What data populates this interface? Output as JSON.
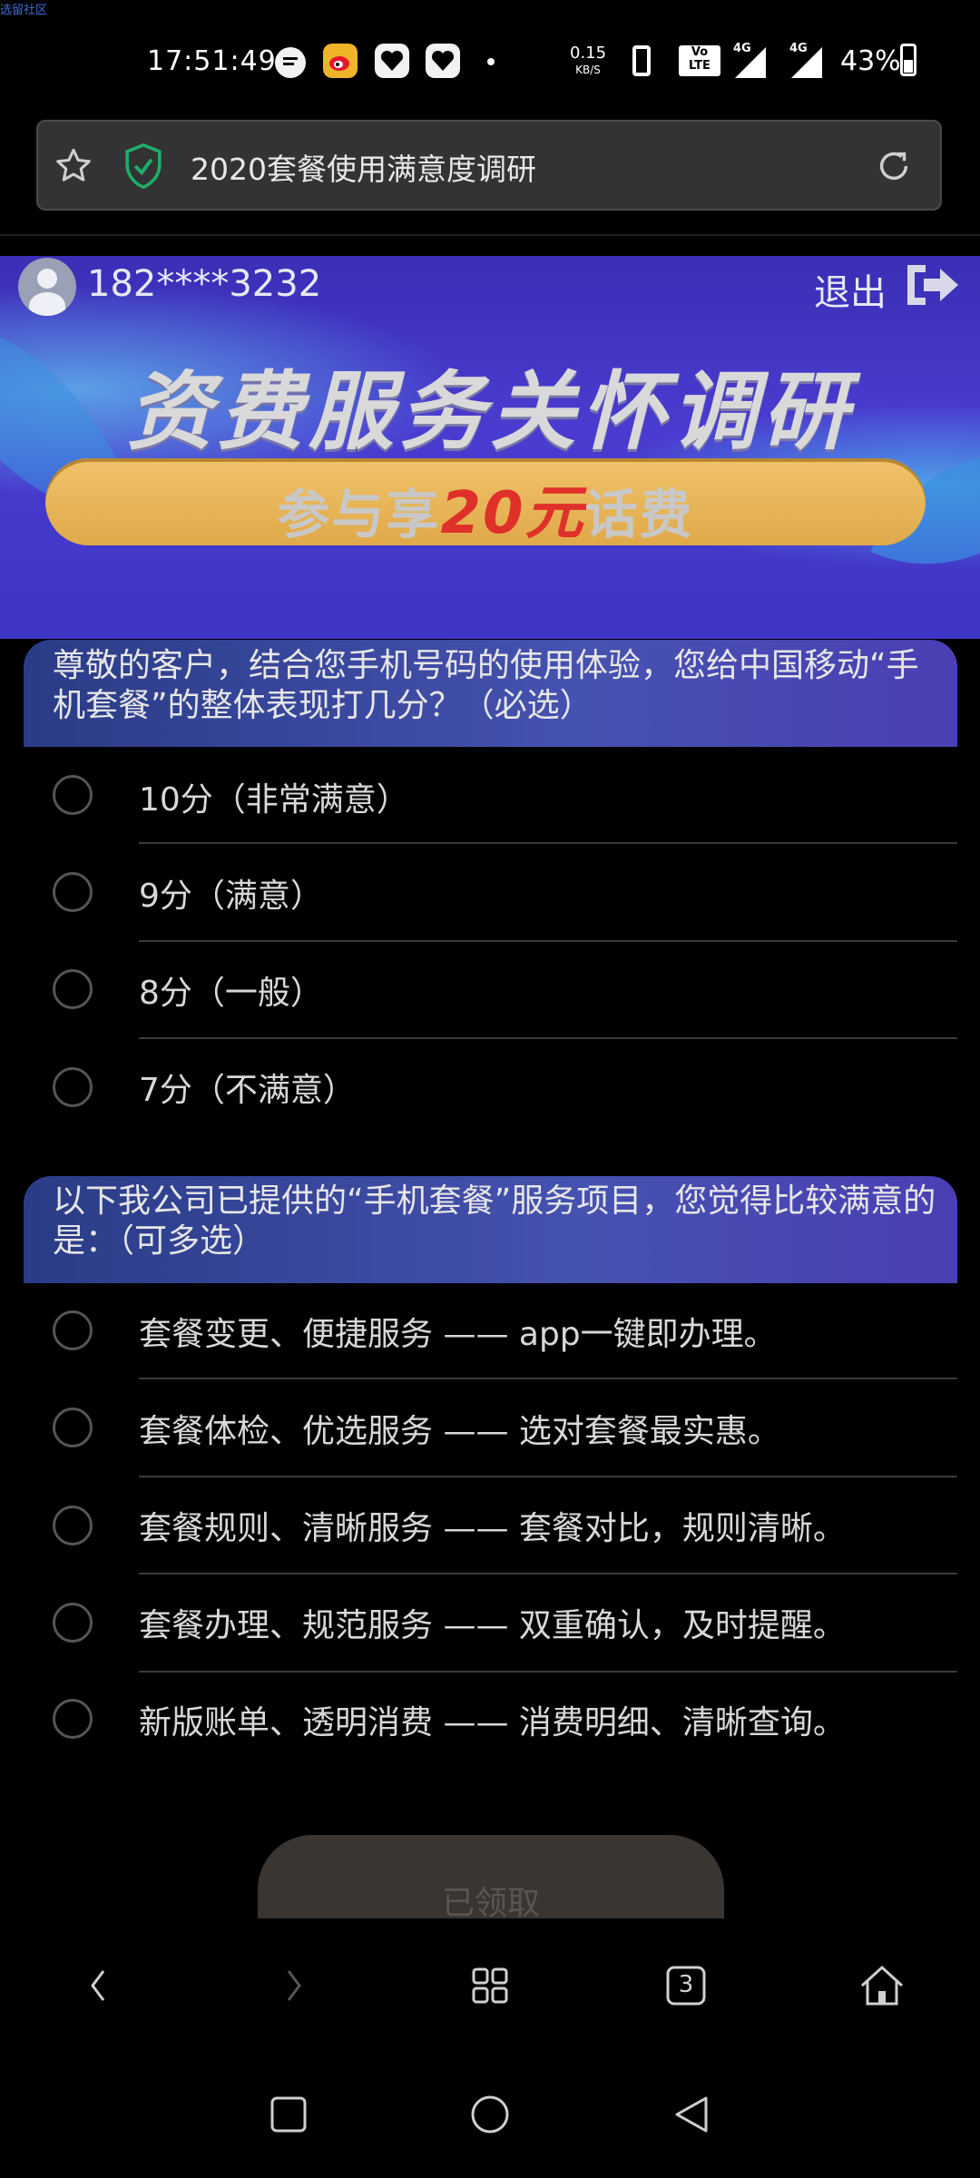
{
  "watermark": "选留社区",
  "status_bar": {
    "time": "17:51:49",
    "net_speed_value": "0.15",
    "net_speed_unit": "KB/S",
    "volte_label": "Vo LTE",
    "signal_label_1": "4G",
    "signal_label_2": "4G",
    "battery": "43%",
    "icons": [
      "message-icon",
      "weibo-icon",
      "heart-app-icon",
      "heart-app-icon",
      "dot-icon",
      "phone-icon",
      "volte-icon",
      "signal-icon",
      "signal-icon",
      "battery-icon"
    ]
  },
  "url_bar": {
    "title": "2020套餐使用满意度调研",
    "icons": [
      "star-icon",
      "shield-icon",
      "reload-icon"
    ]
  },
  "header": {
    "phone": "182****3232",
    "logout": "退出"
  },
  "banner": {
    "title": "资费服务关怀调研",
    "pill_prefix": "参与享",
    "pill_highlight": "20元",
    "pill_suffix": "话费"
  },
  "questions": [
    {
      "text": "尊敬的客户，结合您手机号码的使用体验，您给中国移动“手机套餐”的整体表现打几分？（必选）",
      "options": [
        "10分（非常满意）",
        "9分（满意）",
        "8分（一般）",
        "7分（不满意）"
      ]
    },
    {
      "text": "以下我公司已提供的“手机套餐”服务项目，您觉得比较满意的是：（可多选）",
      "options": [
        "套餐变更、便捷服务 —— app一键即办理。",
        "套餐体检、优选服务 —— 选对套餐最实惠。",
        "套餐规则、清晰服务 —— 套餐对比，规则清晰。",
        "套餐办理、规范服务 —— 双重确认，及时提醒。",
        "新版账单、透明消费 —— 消费明细、清晰查询。"
      ]
    }
  ],
  "submit_label": "已领取",
  "toolbar": {
    "tabs_count": "3",
    "icons": [
      "back-icon",
      "forward-icon",
      "grid-icon",
      "tabs-icon",
      "home-icon"
    ]
  },
  "system_nav": {
    "icons": [
      "recents-icon",
      "home-circle-icon",
      "back-triangle-icon"
    ]
  },
  "colors": {
    "background": "#000000",
    "question_header": "#4652b0",
    "banner": "#4a3cd0",
    "pill": "#e0a94a",
    "highlight": "#e0302a"
  }
}
